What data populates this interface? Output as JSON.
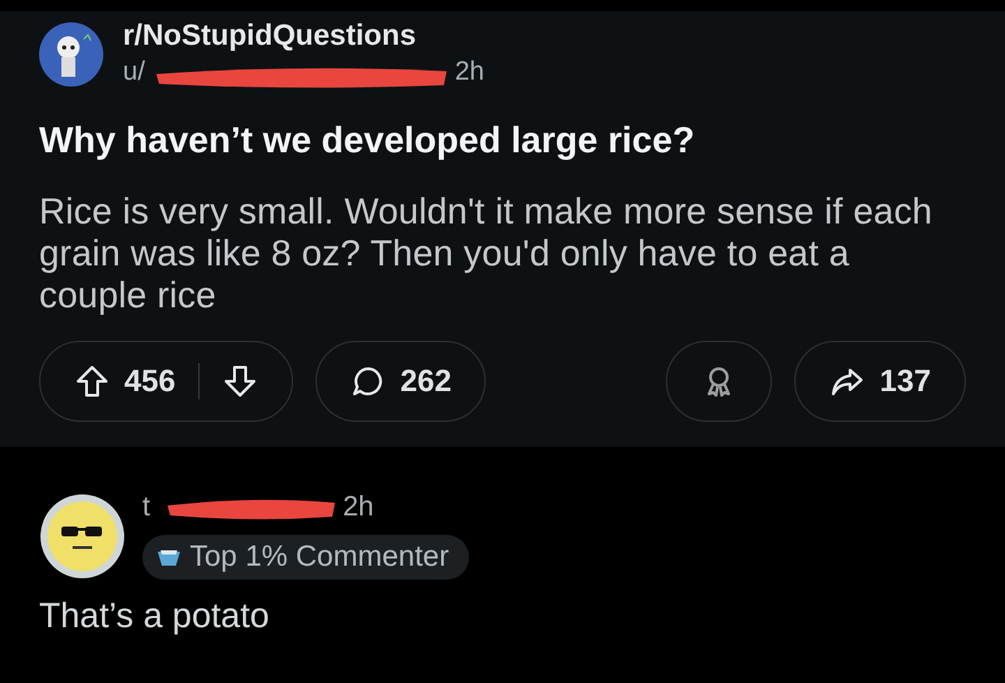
{
  "post": {
    "subreddit": "r/NoStupidQuestions",
    "author": "u/",
    "author_redacted": true,
    "time": "2h",
    "title": "Why haven’t we developed large rice?",
    "body": "Rice is very small. Wouldn't it make more sense if each grain was like 8 oz? Then you'd only have to eat a couple rice",
    "upvotes": "456",
    "comments": "262",
    "shares": "137"
  },
  "comment": {
    "author": "t",
    "author_redacted": true,
    "time": "2h",
    "badge": "Top 1% Commenter",
    "text": "That’s a potato"
  }
}
